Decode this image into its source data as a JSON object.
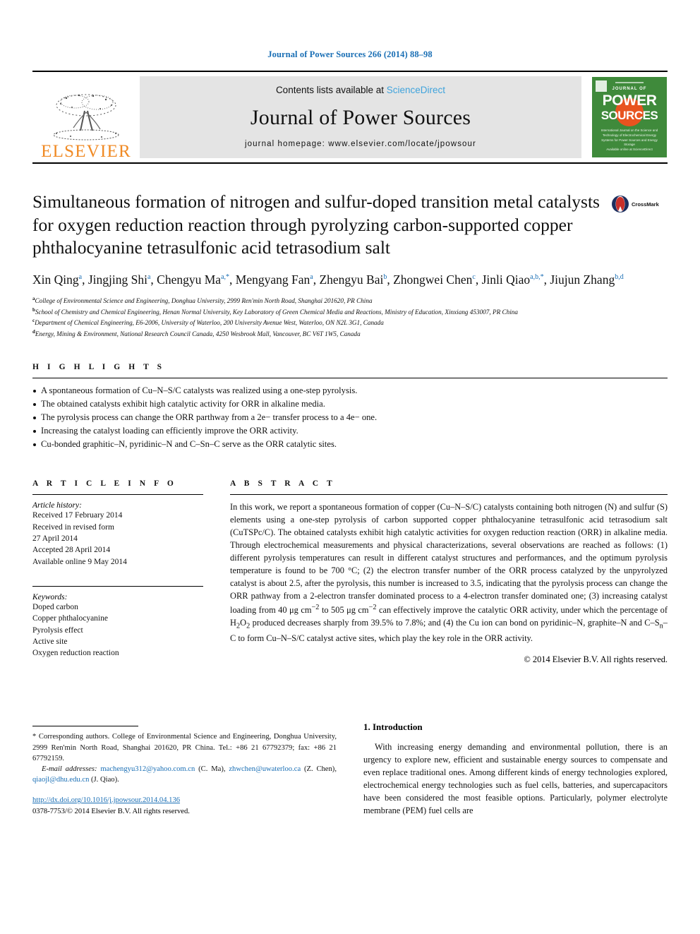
{
  "running_head": "Journal of Power Sources 266 (2014) 88–98",
  "masthead": {
    "publisher": "ELSEVIER",
    "contents_prefix": "Contents lists available at ",
    "sciencedirect": "ScienceDirect",
    "journal_name": "Journal of Power Sources",
    "homepage": "journal homepage: www.elsevier.com/locate/jpowsour",
    "cover": {
      "journal_of": "JOURNAL OF",
      "power": "POWER",
      "sources": "SOURCES",
      "subtitle": "International Journal on the Science and Technology of Electrochemical Energy Systems for Power Sources and Energy Storage",
      "bottom": "Available online at\nScienceDirect"
    },
    "colors": {
      "elsevier_orange": "#f08a24",
      "cover_green": "#3f8a3b",
      "cover_sun": "#e8531f",
      "sciencedirect_blue": "#3fa3dc",
      "banner_grey": "#e4e4e4"
    }
  },
  "article": {
    "title": "Simultaneous formation of nitrogen and sulfur-doped transition metal catalysts for oxygen reduction reaction through pyrolyzing carbon-supported copper phthalocyanine tetrasulfonic acid tetrasodium salt",
    "crossmark_label": "CrossMark",
    "authors": [
      {
        "name": "Xin Qing",
        "marks": "a"
      },
      {
        "name": "Jingjing Shi",
        "marks": "a"
      },
      {
        "name": "Chengyu Ma",
        "marks": "a,*"
      },
      {
        "name": "Mengyang Fan",
        "marks": "a"
      },
      {
        "name": "Zhengyu Bai",
        "marks": "b"
      },
      {
        "name": "Zhongwei Chen",
        "marks": "c"
      },
      {
        "name": "Jinli Qiao",
        "marks": "a,b,*"
      },
      {
        "name": "Jiujun Zhang",
        "marks": "b,d"
      }
    ],
    "affiliations": [
      {
        "mark": "a",
        "text": "College of Environmental Science and Engineering, Donghua University, 2999 Ren'min North Road, Shanghai 201620, PR China"
      },
      {
        "mark": "b",
        "text": "School of Chemistry and Chemical Engineering, Henan Normal University, Key Laboratory of Green Chemical Media and Reactions, Ministry of Education, Xinxiang 453007, PR China"
      },
      {
        "mark": "c",
        "text": "Department of Chemical Engineering, E6-2006, University of Waterloo, 200 University Avenue West, Waterloo, ON N2L 3G1, Canada"
      },
      {
        "mark": "d",
        "text": "Energy, Mining & Environment, National Research Council Canada, 4250 Wesbrook Mall, Vancouver, BC V6T 1W5, Canada"
      }
    ]
  },
  "highlights": {
    "heading": "HIGHLIGHTS",
    "items": [
      "A spontaneous formation of Cu–N–S/C catalysts was realized using a one-step pyrolysis.",
      "The obtained catalysts exhibit high catalytic activity for ORR in alkaline media.",
      "The pyrolysis process can change the ORR parthway from a 2e− transfer process to a 4e− one.",
      "Increasing the catalyst loading can efficiently improve the ORR activity.",
      "Cu-bonded graphitic–N, pyridinic–N and C–Sn–C serve as the ORR catalytic sites."
    ]
  },
  "article_info": {
    "heading": "ARTICLE INFO",
    "history_title": "Article history:",
    "history": [
      "Received 17 February 2014",
      "Received in revised form",
      "27 April 2014",
      "Accepted 28 April 2014",
      "Available online 9 May 2014"
    ],
    "keywords_title": "Keywords:",
    "keywords": [
      "Doped carbon",
      "Copper phthalocyanine",
      "Pyrolysis effect",
      "Active site",
      "Oxygen reduction reaction"
    ]
  },
  "abstract": {
    "heading": "ABSTRACT",
    "text": "In this work, we report a spontaneous formation of copper (Cu–N–S/C) catalysts containing both nitrogen (N) and sulfur (S) elements using a one-step pyrolysis of carbon supported copper phthalocyanine tetrasulfonic acid tetrasodium salt (CuTSPc/C). The obtained catalysts exhibit high catalytic activities for oxygen reduction reaction (ORR) in alkaline media. Through electrochemical measurements and physical characterizations, several observations are reached as follows: (1) different pyrolysis temperatures can result in different catalyst structures and performances, and the optimum pyrolysis temperature is found to be 700 °C; (2) the electron transfer number of the ORR process catalyzed by the unpyrolyzed catalyst is about 2.5, after the pyrolysis, this number is increased to 3.5, indicating that the pyrolysis process can change the ORR pathway from a 2-electron transfer dominated process to a 4-electron transfer dominated one; (3) increasing catalyst loading from 40 μg cm−2 to 505 μg cm−2 can effectively improve the catalytic ORR activity, under which the percentage of H2O2 produced decreases sharply from 39.5% to 7.8%; and (4) the Cu ion can bond on pyridinic–N, graphite–N and C–Sn–C to form Cu–N–S/C catalyst active sites, which play the key role in the ORR activity.",
    "copyright": "© 2014 Elsevier B.V. All rights reserved."
  },
  "introduction": {
    "heading": "1. Introduction",
    "paragraph": "With increasing energy demanding and environmental pollution, there is an urgency to explore new, efficient and sustainable energy sources to compensate and even replace traditional ones. Among different kinds of energy technologies explored, electrochemical energy technologies such as fuel cells, batteries, and supercapacitors have been considered the most feasible options. Particularly, polymer electrolyte membrane (PEM) fuel cells are"
  },
  "footnote": {
    "corresponding": "* Corresponding authors. College of Environmental Science and Engineering, Donghua University, 2999 Ren'min North Road, Shanghai 201620, PR China. Tel.: +86 21 67792379; fax: +86 21 67792159.",
    "email_label": "E-mail addresses:",
    "emails": [
      {
        "address": "machengyu312@yahoo.com.cn",
        "person": "(C. Ma)"
      },
      {
        "address": "zhwchen@uwaterloo.ca",
        "person": "(Z. Chen)"
      },
      {
        "address": "qiaojl@dhu.edu.cn",
        "person": "(J. Qiao)"
      }
    ],
    "doi": "http://dx.doi.org/10.1016/j.jpowsour.2014.04.136",
    "issn": "0378-7753/© 2014 Elsevier B.V. All rights reserved."
  }
}
